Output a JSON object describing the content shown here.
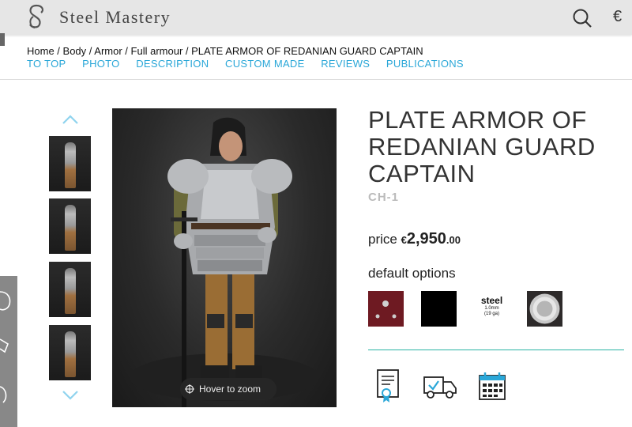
{
  "header": {
    "logo_text": "Steel Mastery",
    "currency": "€"
  },
  "breadcrumb": [
    "Home",
    "Body",
    "Armor",
    "Full armour",
    "PLATE ARMOR OF REDANIAN GUARD CAPTAIN"
  ],
  "anchors": [
    "TO TOP",
    "PHOTO",
    "DESCRIPTION",
    "CUSTOM MADE",
    "REVIEWS",
    "PUBLICATIONS"
  ],
  "gallery": {
    "zoom_hint": "Hover to zoom",
    "thumbnail_count": 4
  },
  "product": {
    "title": "PLATE ARMOR OF REDANIAN GUARD CAPTAIN",
    "sku": "CH-1",
    "price_label": "price",
    "price_currency": "€",
    "price_main": "2,950",
    "price_cents": ".00",
    "options_label": "default options",
    "option_steel": "steel",
    "option_steel_detail_1": "1.0mm",
    "option_steel_detail_2": "(19 ga)"
  },
  "colors": {
    "accent": "#2aa7d8",
    "divider_teal": "#2ab3a4",
    "leather_swatch": "#6e1a22"
  },
  "icons": [
    "logo-icon",
    "search-icon",
    "chevron-up-icon",
    "chevron-down-icon",
    "zoom-target-icon",
    "certificate-icon",
    "delivery-truck-icon",
    "calendar-icon"
  ]
}
